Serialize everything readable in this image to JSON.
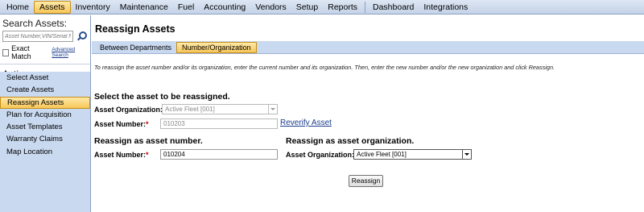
{
  "topnav": {
    "items": [
      "Home",
      "Assets",
      "Inventory",
      "Maintenance",
      "Fuel",
      "Accounting",
      "Vendors",
      "Setup",
      "Reports",
      "Dashboard",
      "Integrations"
    ],
    "active": "Assets"
  },
  "sidebar": {
    "search_title": "Search Assets:",
    "search_placeholder": "Asset Number,VIN/Serial Number",
    "exact_match_label": "Exact Match",
    "advanced_search_label": "Advanced Search",
    "actions_title": "Actions:",
    "actions": [
      "Select Asset",
      "Create Assets",
      "Reassign Assets",
      "Plan for Acquisition",
      "Asset Templates",
      "Warranty Claims",
      "Map Location"
    ],
    "active_action": "Reassign Assets"
  },
  "main": {
    "title": "Reassign Assets",
    "tabs": [
      "Between Departments",
      "Number/Organization"
    ],
    "active_tab": "Number/Organization",
    "instructions": "To reassign the asset number and/or its organization, enter the current number and its organization. Then, enter the new number and/or the new organization and click Reassign.",
    "select_section": {
      "heading": "Select the asset to be reassigned.",
      "org_label": "Asset Organization:",
      "org_value": "Active Fleet [001]",
      "number_label": "Asset Number:",
      "number_value": "010203",
      "reverify_label": "Reverify Asset"
    },
    "new_number_section": {
      "heading": "Reassign as asset number.",
      "number_label": "Asset Number:",
      "number_value": "010204"
    },
    "new_org_section": {
      "heading": "Reassign as asset organization.",
      "org_label": "Asset Organization:",
      "org_value": "Active Fleet [001]"
    },
    "reassign_button": "Reassign",
    "required_marker": "*"
  }
}
